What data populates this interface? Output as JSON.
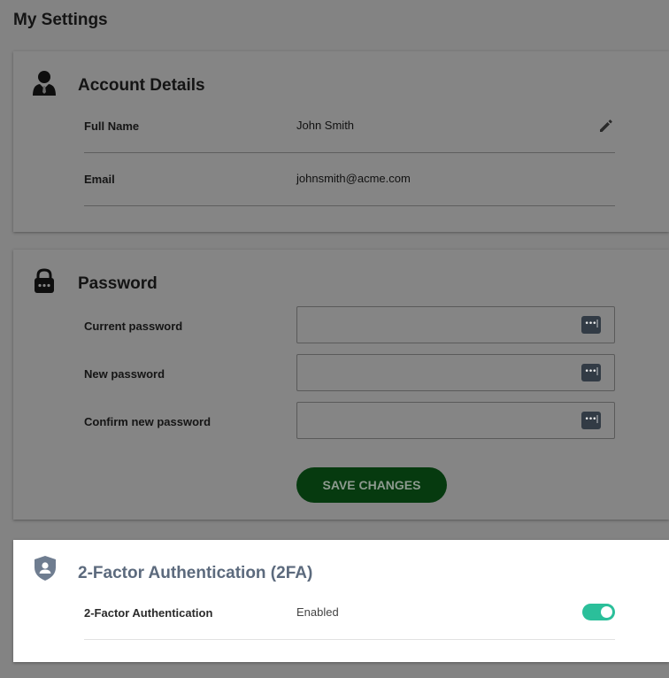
{
  "page": {
    "title": "My Settings"
  },
  "account": {
    "title": "Account Details",
    "icon": "user-icon",
    "rows": [
      {
        "label": "Full Name",
        "value": "John Smith"
      },
      {
        "label": "Email",
        "value": "johnsmith@acme.com"
      }
    ]
  },
  "password": {
    "title": "Password",
    "icon": "lock-icon",
    "fields": [
      {
        "label": "Current password",
        "value": "",
        "placeholder": ""
      },
      {
        "label": "New password",
        "value": "",
        "placeholder": ""
      },
      {
        "label": "Confirm new password",
        "value": "",
        "placeholder": ""
      }
    ],
    "reveal_glyph": "•••|",
    "save_label": "SAVE CHANGES"
  },
  "tfa": {
    "title": "2-Factor Authentication (2FA)",
    "icon": "shield-user-icon",
    "row": {
      "label": "2-Factor Authentication",
      "value": "Enabled",
      "toggle_on": true
    }
  },
  "colors": {
    "overlay_bg": "#838383",
    "save_button": "#063a0f",
    "toggle_on": "#2bbf9a",
    "tfa_title": "#5c6a7d"
  }
}
